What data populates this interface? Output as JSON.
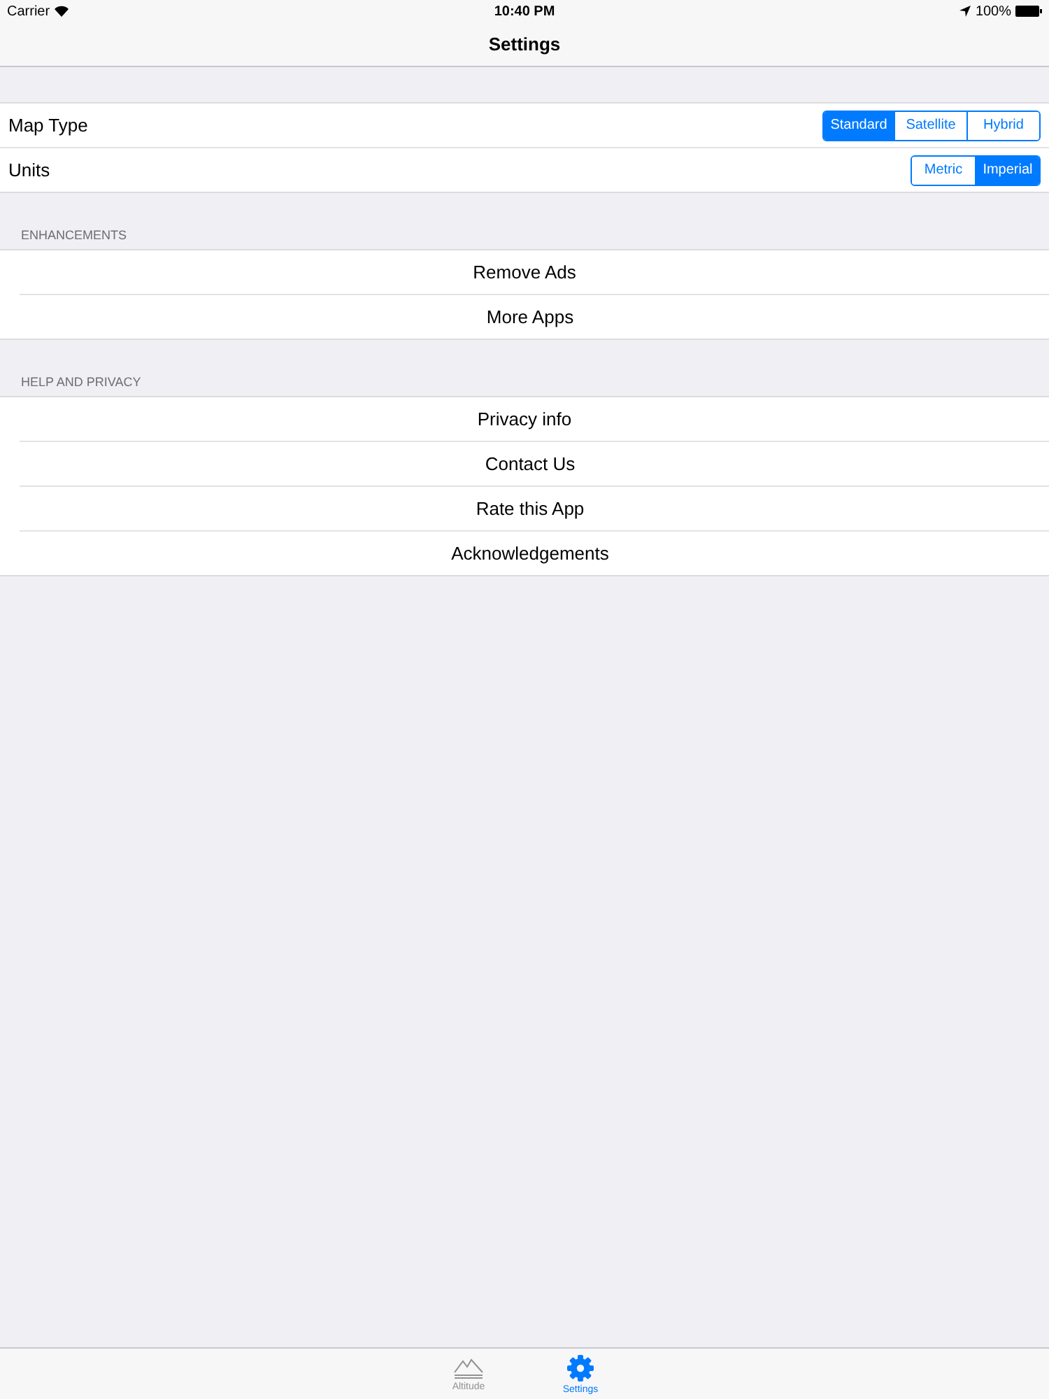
{
  "status_bar": {
    "carrier": "Carrier",
    "time": "10:40 PM",
    "battery": "100%"
  },
  "nav_bar": {
    "title": "Settings"
  },
  "settings": [
    {
      "label": "Map Type",
      "options": [
        {
          "label": "Standard",
          "selected": true
        },
        {
          "label": "Satellite",
          "selected": false
        },
        {
          "label": "Hybrid",
          "selected": false
        }
      ]
    },
    {
      "label": "Units",
      "options": [
        {
          "label": "Metric",
          "selected": false
        },
        {
          "label": "Imperial",
          "selected": true
        }
      ]
    }
  ],
  "sections": [
    {
      "header": "ENHANCEMENTS",
      "items": [
        "Remove Ads",
        "More Apps"
      ]
    },
    {
      "header": "HELP AND PRIVACY",
      "items": [
        "Privacy info",
        "Contact Us",
        "Rate this App",
        "Acknowledgements"
      ]
    }
  ],
  "tab_bar": [
    {
      "kind": "altitude",
      "label": "Altitude",
      "selected": false
    },
    {
      "kind": "settings",
      "label": "Settings",
      "selected": true
    }
  ]
}
